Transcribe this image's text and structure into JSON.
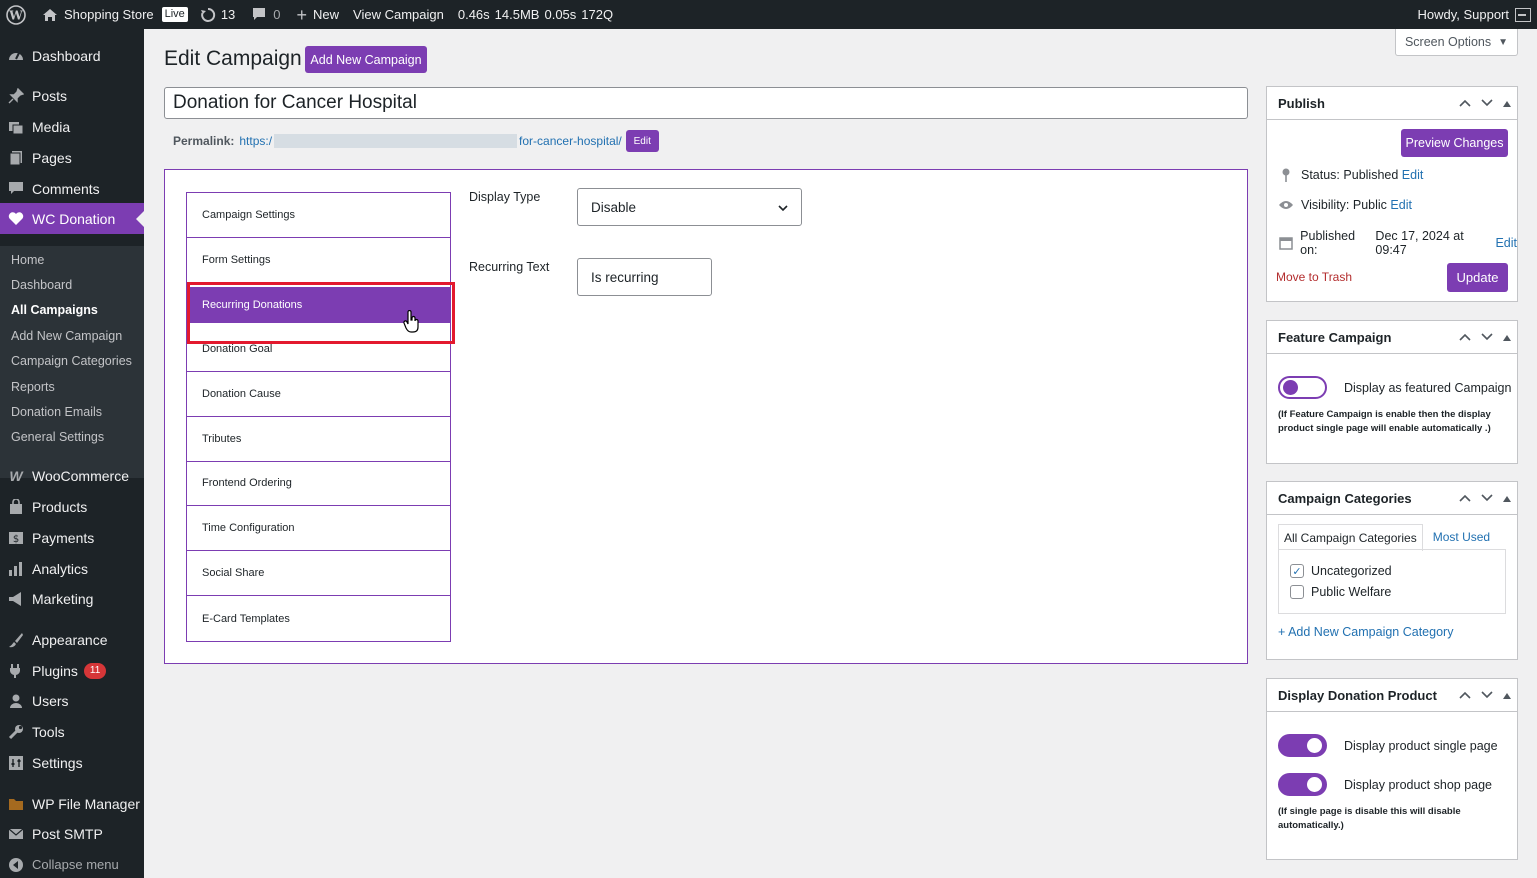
{
  "adminbar": {
    "site_name": "Shopping Store",
    "live_badge": "Live",
    "updates_count": "13",
    "comments_count": "0",
    "new_label": "New",
    "view_label": "View Campaign",
    "perf_time": "0.46s",
    "perf_mem": "14.5MB",
    "perf_query_time": "0.05s",
    "perf_queries": "172Q",
    "howdy": "Howdy, Support"
  },
  "sidebar": {
    "dashboard": "Dashboard",
    "posts": "Posts",
    "media": "Media",
    "pages": "Pages",
    "comments": "Comments",
    "wc_donation": "WC Donation",
    "submenu": [
      "Home",
      "Dashboard",
      "All Campaigns",
      "Add New Campaign",
      "Campaign Categories",
      "Reports",
      "Donation Emails",
      "General Settings"
    ],
    "woocommerce": "WooCommerce",
    "products": "Products",
    "payments": "Payments",
    "analytics": "Analytics",
    "marketing": "Marketing",
    "appearance": "Appearance",
    "plugins": "Plugins",
    "plugins_badge": "11",
    "users": "Users",
    "tools": "Tools",
    "settings": "Settings",
    "file_manager": "WP File Manager",
    "post_smtp": "Post SMTP",
    "collapse": "Collapse menu"
  },
  "screen_options": "Screen Options",
  "header": {
    "title": "Edit Campaign",
    "add_new": "Add New Campaign"
  },
  "post_title": "Donation for Cancer Hospital",
  "permalink": {
    "label": "Permalink:",
    "prefix": "https:/",
    "suffix": "for-cancer-hospital/",
    "edit": "Edit"
  },
  "tabs": [
    "Campaign Settings",
    "Form Settings",
    "Recurring Donations",
    "Donation Goal",
    "Donation Cause",
    "Tributes",
    "Frontend Ordering",
    "Time Configuration",
    "Social Share",
    "E-Card Templates"
  ],
  "recurring": {
    "display_type_label": "Display Type",
    "display_type_value": "Disable",
    "recurring_text_label": "Recurring Text",
    "recurring_text_value": "Is recurring"
  },
  "publish": {
    "title": "Publish",
    "preview": "Preview Changes",
    "status_label": "Status:",
    "status_value": "Published",
    "visibility_label": "Visibility:",
    "visibility_value": "Public",
    "published_label": "Published on:",
    "published_value": "Dec 17, 2024 at 09:47",
    "edit": "Edit",
    "trash": "Move to Trash",
    "update": "Update"
  },
  "feature": {
    "title": "Feature Campaign",
    "toggle_label": "Display as featured Campaign",
    "toggle_on": false,
    "note": "(If Feature Campaign is enable then the display product single page will enable automatically .)"
  },
  "categories": {
    "title": "Campaign Categories",
    "tab_all": "All Campaign Categories",
    "tab_most": "Most Used",
    "items": [
      {
        "label": "Uncategorized",
        "checked": true
      },
      {
        "label": "Public Welfare",
        "checked": false
      }
    ],
    "add_new": "+ Add New Campaign Category"
  },
  "display_product": {
    "title": "Display Donation Product",
    "single_label": "Display product single page",
    "single_on": true,
    "shop_label": "Display product shop page",
    "shop_on": true,
    "note": "(If single page is disable this will disable automatically.)"
  },
  "colors": {
    "accent": "#7c3db2",
    "highlight_box": "#e3192e",
    "admin_dark": "#1d2327",
    "link": "#2271b1"
  }
}
